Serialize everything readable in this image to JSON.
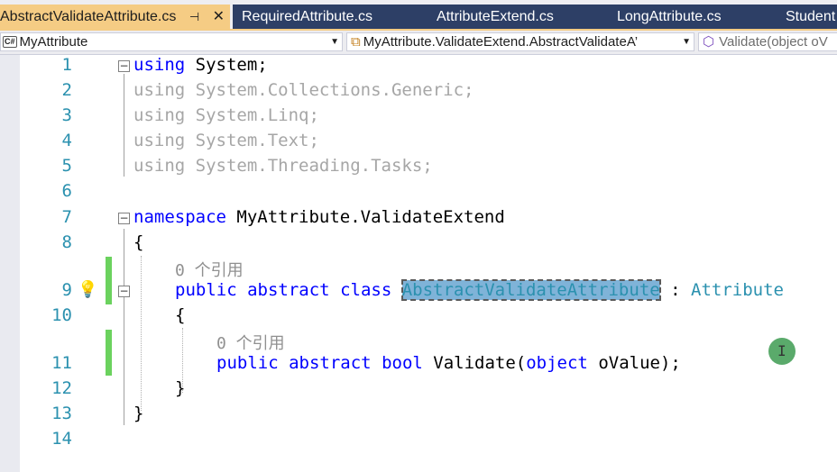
{
  "tabs": [
    {
      "label": "AbstractValidateAttribute.cs",
      "pin": "⊣",
      "close": "✕",
      "active": true
    },
    {
      "label": "RequiredAttribute.cs"
    },
    {
      "label": "AttributeExtend.cs"
    },
    {
      "label": "LongAttribute.cs"
    },
    {
      "label": "Student"
    }
  ],
  "navbar": {
    "project_icon": "C#",
    "project": "MyAttribute",
    "type": "MyAttribute.ValidateExtend.AbstractValidateA’",
    "member": "Validate(object oV"
  },
  "editor": {
    "line_numbers": [
      "1",
      "2",
      "3",
      "4",
      "5",
      "6",
      "7",
      "8",
      "9",
      "10",
      "11",
      "12",
      "13",
      "14"
    ],
    "l1": {
      "kw": "using",
      "text": " System;"
    },
    "l2": {
      "kw": "using",
      "text": " System.Collections.Generic;"
    },
    "l3": {
      "kw": "using",
      "text": " System.Linq;"
    },
    "l4": {
      "kw": "using",
      "text": " System.Text;"
    },
    "l5": {
      "kw": "using",
      "text": " System.Threading.Tasks;"
    },
    "l7": {
      "kw": "namespace",
      "text": " MyAttribute.ValidateExtend"
    },
    "l8": {
      "text": "{"
    },
    "ref1": "0 个引用",
    "l9": {
      "kw1": "public",
      "kw2": "abstract",
      "kw3": "class",
      "name": "AbstractValidateAttribute",
      "colon": " : ",
      "base": "Attribute"
    },
    "l10": {
      "text": "{"
    },
    "ref2": "0 个引用",
    "l11": {
      "kw1": "public",
      "kw2": "abstract",
      "kw3": "bool",
      "method": "Validate(",
      "kw4": "object",
      "rest": " oValue);"
    },
    "l12": {
      "text": "}"
    },
    "l13": {
      "text": "}"
    }
  },
  "icons": {
    "lightbulb": "lightbulb-icon",
    "fold": "collapse-icon"
  }
}
